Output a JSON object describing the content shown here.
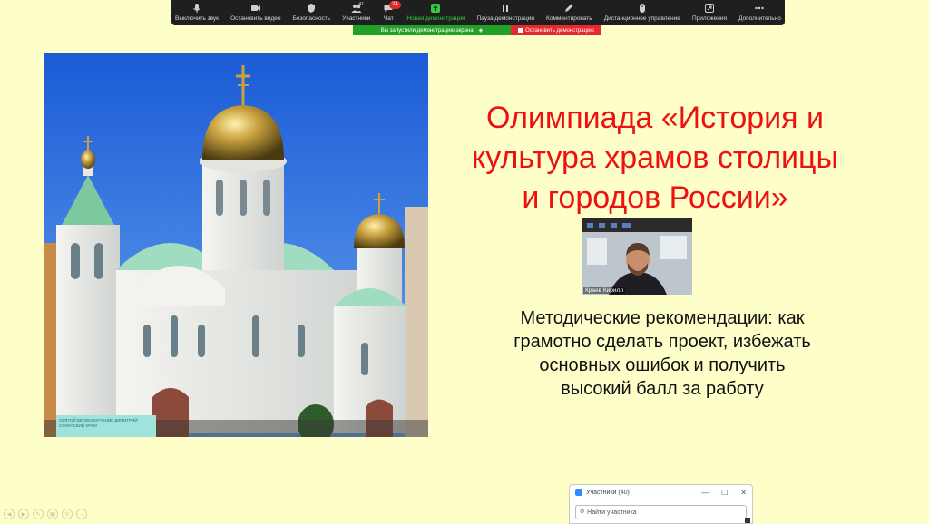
{
  "toolbar": {
    "mute": "Выключить звук",
    "stop_video": "Остановить видео",
    "security": "Безопасность",
    "participants": "Участники",
    "participants_count": "41",
    "chat": "Чат",
    "chat_badge": "24",
    "new_share": "Новая демонстрация",
    "pause_share": "Пауза демонстрации",
    "annotate": "Комментировать",
    "remote_control": "Дистанционное управление",
    "apps": "Приложения",
    "more": "Дополнительно"
  },
  "share_bar": {
    "status": "Вы запустили демонстрацию экрана",
    "stop": "Остановить демонстрацию"
  },
  "slide": {
    "title_lines": [
      "Олимпиада «История и",
      "культура храмов столицы",
      "и городов России»"
    ],
    "subtitle_lines": [
      "Методические рекомендации: как",
      "грамотно сделать проект, избежать",
      "основных ошибок и получить",
      "высокий балл за работу"
    ],
    "plate_text": "СВЯТОЙ ВЕЛИКОМУЧЕНИК ДИМИТРИЙ СОЛУНСКИЙ ХРАМ"
  },
  "video": {
    "name": "Краев Кирилл"
  },
  "participants_panel": {
    "title": "Участники (40)",
    "search_placeholder": "Найти участника",
    "minimize": "—",
    "maximize": "☐",
    "close": "✕"
  },
  "colors": {
    "slide_bg": "#fefec8",
    "title": "#ee1111",
    "toolbar_bg": "#1f1f1f",
    "share_green": "#23a028",
    "share_red": "#e5292f"
  }
}
